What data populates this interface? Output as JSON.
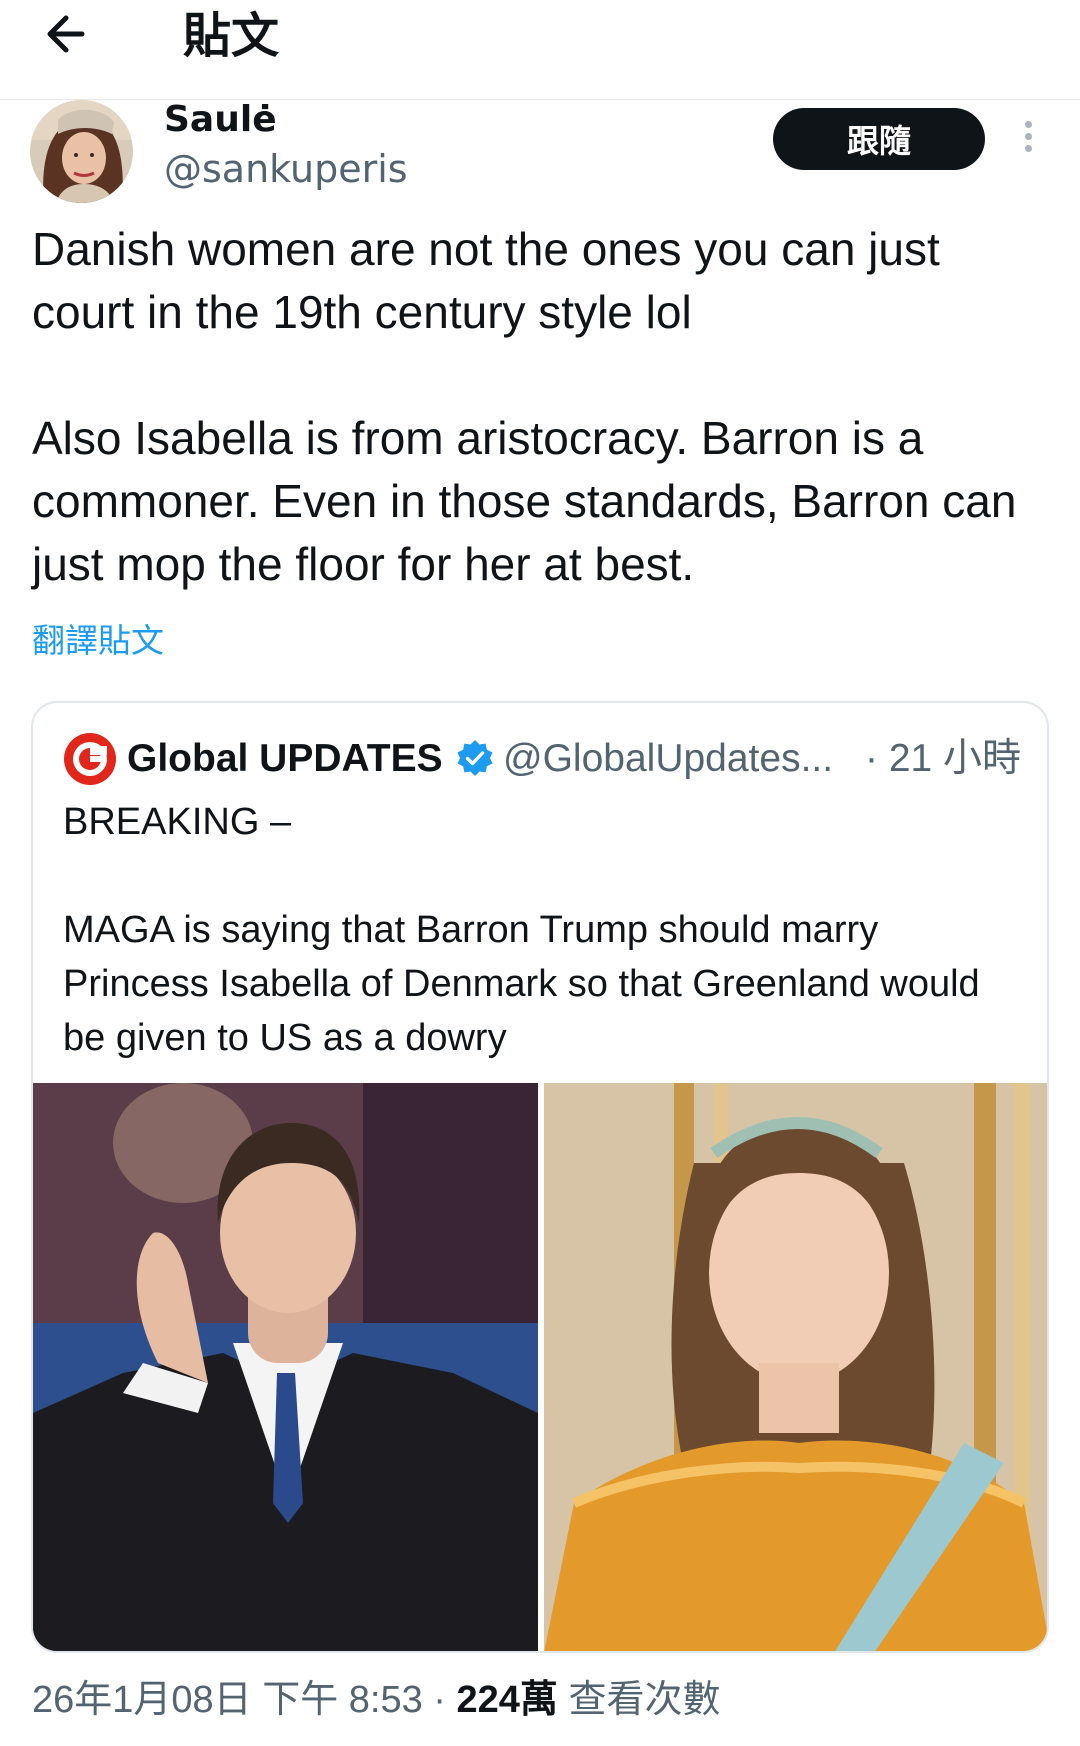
{
  "header": {
    "title": "貼文",
    "back_icon": "arrow-left-icon"
  },
  "author": {
    "name": "Saulė",
    "handle": "@sankuperis",
    "follow_label": "跟隨",
    "more_icon": "more-vertical-icon"
  },
  "tweet": {
    "text": "Danish women are not the ones you can just court in the 19th century style lol\n\nAlso Isabella is from aristocracy. Barron is a commoner. Even in those standards, Barron can just mop the floor for her at best.",
    "translate_label": "翻譯貼文"
  },
  "quote": {
    "name": "Global UPDATES",
    "handle": "@GlobalUpdates...",
    "time": "· 21 小時",
    "text": "BREAKING –\n\nMAGA is saying that Barron Trump should marry Princess Isabella of Denmark so that Greenland would be given to US as a dowry",
    "logo_icon": "global-updates-logo",
    "verified_icon": "verified-badge-icon"
  },
  "meta": {
    "datetime": "26年1月08日 下午 8:53",
    "separator": " · ",
    "views_count": "224萬",
    "views_label": " 查看次數"
  },
  "colors": {
    "accent": "#1d9bf0",
    "text": "#0f1419",
    "secondary": "#536471",
    "follow_bg": "#0f1419",
    "logo_red": "#e1261c"
  }
}
